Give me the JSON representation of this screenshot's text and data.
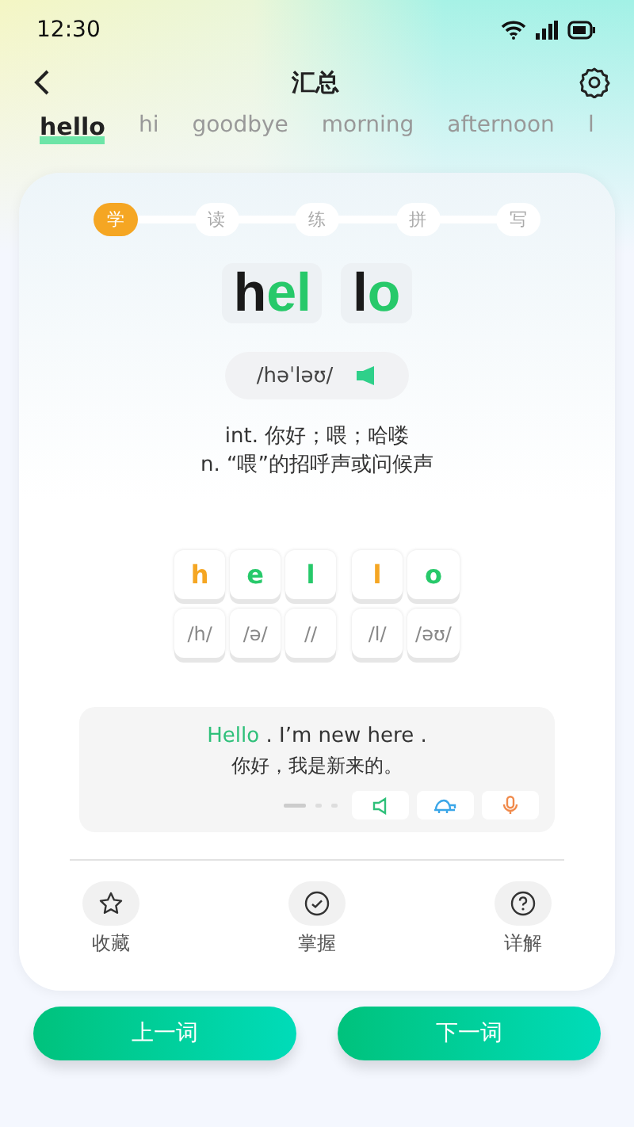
{
  "status_bar": {
    "time": "12:30"
  },
  "nav": {
    "title": "汇总"
  },
  "tabs": [
    {
      "label": "hello",
      "selected": true
    },
    {
      "label": "hi",
      "selected": false
    },
    {
      "label": "goodbye",
      "selected": false
    },
    {
      "label": "morning",
      "selected": false
    },
    {
      "label": "afternoon",
      "selected": false
    },
    {
      "label": "l",
      "selected": false
    }
  ],
  "steps": [
    {
      "label": "学",
      "selected": true
    },
    {
      "label": "读",
      "selected": false
    },
    {
      "label": "练",
      "selected": false
    },
    {
      "label": "拼",
      "selected": false
    },
    {
      "label": "写",
      "selected": false
    }
  ],
  "syllables": [
    [
      {
        "text": "h",
        "kind": "plain"
      },
      {
        "text": "el",
        "kind": "highlight"
      }
    ],
    [
      {
        "text": "l",
        "kind": "plain"
      },
      {
        "text": "o",
        "kind": "highlight"
      }
    ]
  ],
  "phonetic": "/həˈləʊ/",
  "definitions": [
    "int. 你好；喂；哈喽",
    "n. “喂”的招呼声或问候声"
  ],
  "letter_groups": [
    [
      {
        "letter": "h",
        "sound": "/h/",
        "color": "#f5a623"
      },
      {
        "letter": "e",
        "sound": "/ə/",
        "color": "#27c96a"
      },
      {
        "letter": "l",
        "sound": "//",
        "color": "#27c96a"
      }
    ],
    [
      {
        "letter": "l",
        "sound": "/l/",
        "color": "#f5a623"
      },
      {
        "letter": "o",
        "sound": "/əʊ/",
        "color": "#27c96a"
      }
    ]
  ],
  "example": {
    "parts": [
      {
        "text": "Hello",
        "kind": "highlight"
      },
      {
        "text": " . I’m new here .",
        "kind": "plain"
      }
    ],
    "translation": "你好，我是新来的。"
  },
  "actions": [
    {
      "label": "收藏",
      "kind": "favorite"
    },
    {
      "label": "掌握",
      "kind": "mastered"
    },
    {
      "label": "详解",
      "kind": "details"
    }
  ],
  "buttons": [
    "上一词",
    "下一词"
  ]
}
